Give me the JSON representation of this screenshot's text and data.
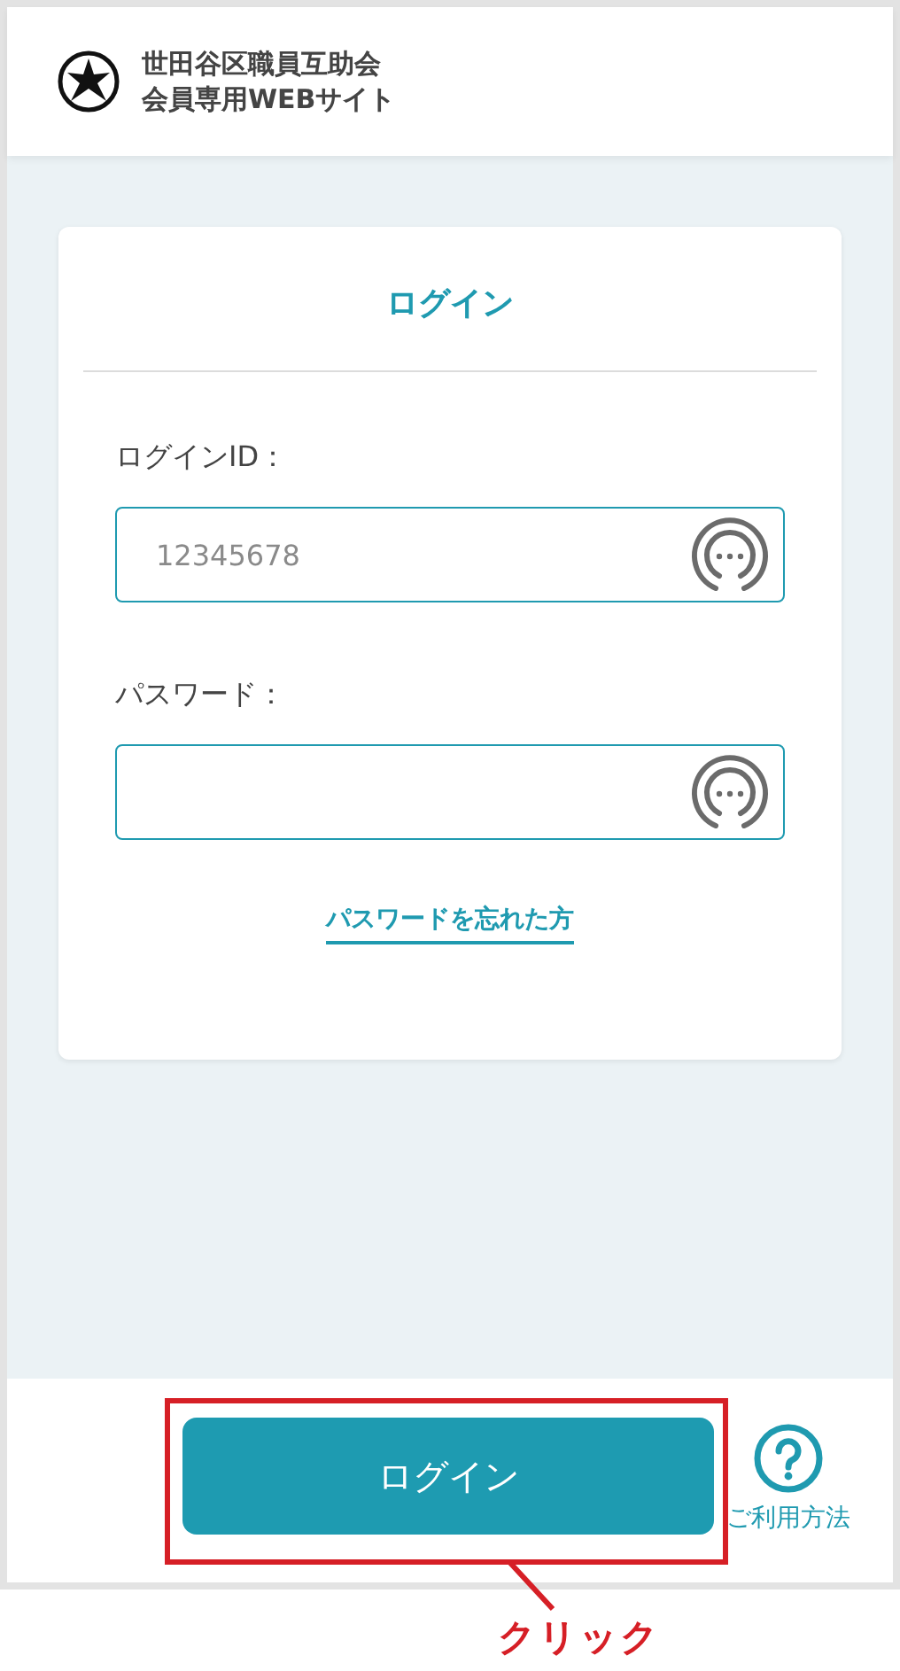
{
  "header": {
    "title_lines": [
      "世田谷区職員互助会",
      "会員専用WEBサイト"
    ]
  },
  "login_card": {
    "title": "ログイン",
    "fields": [
      {
        "label": "ログインID：",
        "placeholder": "12345678"
      },
      {
        "label": "パスワード："
      }
    ],
    "forgot_link": "パスワードを忘れた方"
  },
  "footer": {
    "login_button": "ログイン",
    "help_link": "ご利用方法"
  },
  "annotation": {
    "label": "クリック"
  }
}
